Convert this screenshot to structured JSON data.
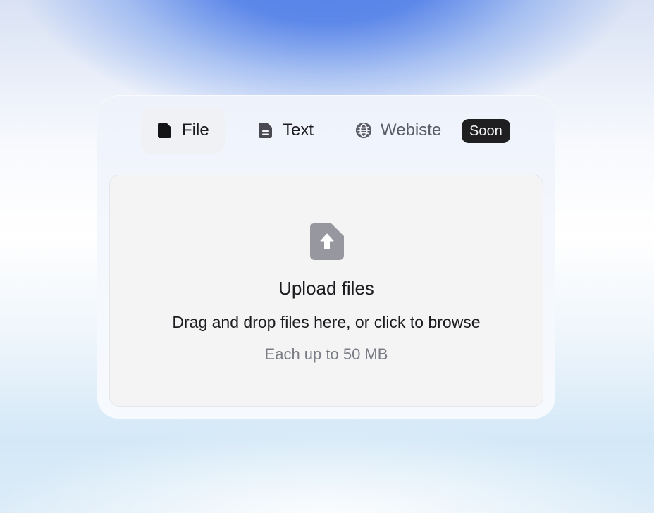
{
  "tabs": [
    {
      "label": "File",
      "icon": "file-icon",
      "active": true
    },
    {
      "label": "Text",
      "icon": "document-text-icon",
      "active": false
    },
    {
      "label": "Webiste",
      "icon": "globe-icon",
      "active": false
    }
  ],
  "badge": {
    "label": "Soon"
  },
  "dropzone": {
    "icon": "file-upload-icon",
    "title": "Upload files",
    "subtitle": "Drag and drop files here, or click to browse",
    "note": "Each up to 50 MB"
  },
  "colors": {
    "background_top": "#5280e8",
    "background_bottom": "#d3e8f7",
    "card": "#f4f7fd",
    "active_tab": "#f0f1f4",
    "badge_bg": "#1f1f22",
    "dropzone_bg": "#f4f4f5",
    "icon_gray": "#97979f",
    "text_primary": "#1c1c20",
    "text_muted": "#7b7d85"
  }
}
